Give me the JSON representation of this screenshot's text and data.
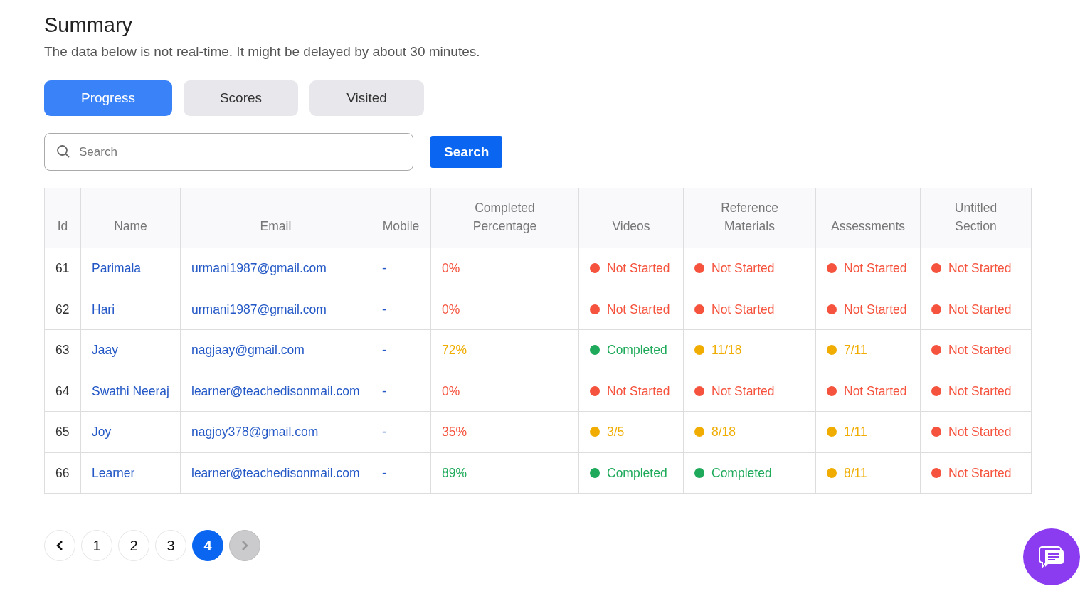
{
  "title": "Summary",
  "subtitle": "The data below is not real-time. It might be delayed by about 30 minutes.",
  "tabs": [
    {
      "label": "Progress",
      "selected": true
    },
    {
      "label": "Scores",
      "selected": false
    },
    {
      "label": "Visited",
      "selected": false
    }
  ],
  "search": {
    "placeholder": "Search",
    "button": "Search"
  },
  "table": {
    "columns": [
      "Id",
      "Name",
      "Email",
      "Mobile",
      "Completed Percentage",
      "Videos",
      "Reference Materials",
      "Assessments",
      "Untitled Section"
    ],
    "rows": [
      {
        "id": "61",
        "name": "Parimala",
        "email": "urmani1987@gmail.com",
        "mobile": "-",
        "percentage": {
          "text": "0%",
          "color": "#f5533d"
        },
        "statuses": [
          {
            "text": "Not Started",
            "color": "#f5533d"
          },
          {
            "text": "Not Started",
            "color": "#f5533d"
          },
          {
            "text": "Not Started",
            "color": "#f5533d"
          },
          {
            "text": "Not Started",
            "color": "#f5533d"
          }
        ]
      },
      {
        "id": "62",
        "name": "Hari",
        "email": "urmani1987@gmail.com",
        "mobile": "-",
        "percentage": {
          "text": "0%",
          "color": "#f5533d"
        },
        "statuses": [
          {
            "text": "Not Started",
            "color": "#f5533d"
          },
          {
            "text": "Not Started",
            "color": "#f5533d"
          },
          {
            "text": "Not Started",
            "color": "#f5533d"
          },
          {
            "text": "Not Started",
            "color": "#f5533d"
          }
        ]
      },
      {
        "id": "63",
        "name": "Jaay",
        "email": "nagjaay@gmail.com",
        "mobile": "-",
        "percentage": {
          "text": "72%",
          "color": "#f0ad00"
        },
        "statuses": [
          {
            "text": "Completed",
            "color": "#1eaa5a"
          },
          {
            "text": "11/18",
            "color": "#f0ad00"
          },
          {
            "text": "7/11",
            "color": "#f0ad00"
          },
          {
            "text": "Not Started",
            "color": "#f5533d"
          }
        ]
      },
      {
        "id": "64",
        "name": "Swathi Neeraj",
        "email": "learner@teachedisonmail.com",
        "mobile": "-",
        "percentage": {
          "text": "0%",
          "color": "#f5533d"
        },
        "statuses": [
          {
            "text": "Not Started",
            "color": "#f5533d"
          },
          {
            "text": "Not Started",
            "color": "#f5533d"
          },
          {
            "text": "Not Started",
            "color": "#f5533d"
          },
          {
            "text": "Not Started",
            "color": "#f5533d"
          }
        ]
      },
      {
        "id": "65",
        "name": "Joy",
        "email": "nagjoy378@gmail.com",
        "mobile": "-",
        "percentage": {
          "text": "35%",
          "color": "#f5533d"
        },
        "statuses": [
          {
            "text": "3/5",
            "color": "#f0ad00"
          },
          {
            "text": "8/18",
            "color": "#f0ad00"
          },
          {
            "text": "1/11",
            "color": "#f0ad00"
          },
          {
            "text": "Not Started",
            "color": "#f5533d"
          }
        ]
      },
      {
        "id": "66",
        "name": "Learner",
        "email": "learner@teachedisonmail.com",
        "mobile": "-",
        "percentage": {
          "text": "89%",
          "color": "#1eaa5a"
        },
        "statuses": [
          {
            "text": "Completed",
            "color": "#1eaa5a"
          },
          {
            "text": "Completed",
            "color": "#1eaa5a"
          },
          {
            "text": "8/11",
            "color": "#f0ad00"
          },
          {
            "text": "Not Started",
            "color": "#f5533d"
          }
        ]
      }
    ]
  },
  "pagination": {
    "prev_disabled": false,
    "next_disabled": true,
    "pages": [
      {
        "label": "1",
        "selected": false
      },
      {
        "label": "2",
        "selected": false
      },
      {
        "label": "3",
        "selected": false
      },
      {
        "label": "4",
        "selected": true
      }
    ]
  }
}
